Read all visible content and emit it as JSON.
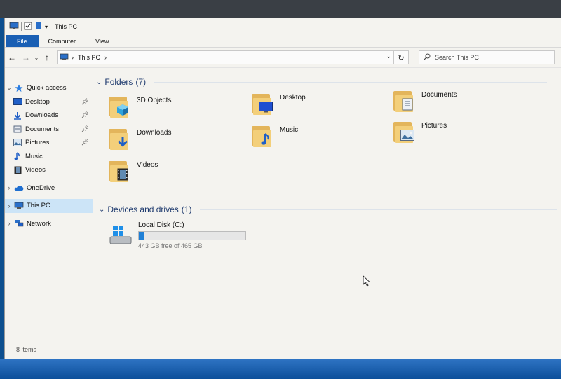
{
  "window": {
    "title": "This PC",
    "tabs": [
      "File",
      "Computer",
      "View"
    ]
  },
  "address": {
    "path": "This PC",
    "search_placeholder": "Search This PC"
  },
  "nav": {
    "quick_access": "Quick access",
    "quick_items": [
      {
        "label": "Desktop",
        "icon": "desktop-icon",
        "pinned": true
      },
      {
        "label": "Downloads",
        "icon": "download-arrow-icon",
        "pinned": true
      },
      {
        "label": "Documents",
        "icon": "documents-icon",
        "pinned": true
      },
      {
        "label": "Pictures",
        "icon": "pictures-icon",
        "pinned": true
      },
      {
        "label": "Music",
        "icon": "music-note-icon",
        "pinned": false
      },
      {
        "label": "Videos",
        "icon": "film-strip-icon",
        "pinned": false
      }
    ],
    "onedrive": "OneDrive",
    "this_pc": "This PC",
    "network": "Network"
  },
  "folders": {
    "header": "Folders",
    "count": "(7)",
    "items": [
      {
        "label": "3D Objects",
        "icon": "3d-cube-icon"
      },
      {
        "label": "Desktop",
        "icon": "desktop-icon"
      },
      {
        "label": "Documents",
        "icon": "documents-icon"
      },
      {
        "label": "Downloads",
        "icon": "download-arrow-icon"
      },
      {
        "label": "Music",
        "icon": "music-note-icon"
      },
      {
        "label": "Pictures",
        "icon": "pictures-icon"
      },
      {
        "label": "Videos",
        "icon": "film-strip-icon"
      }
    ]
  },
  "devices": {
    "header": "Devices and drives",
    "count": "(1)",
    "drive": {
      "label": "Local Disk (C:)",
      "free_text": "443 GB free of 465 GB",
      "used_fraction": 0.047
    }
  },
  "status": {
    "items": "8 items"
  },
  "colors": {
    "accent": "#1a5fb4",
    "selected": "#cce4f7",
    "folder": "#f3cf7a",
    "bar": "#1f7fd6"
  }
}
